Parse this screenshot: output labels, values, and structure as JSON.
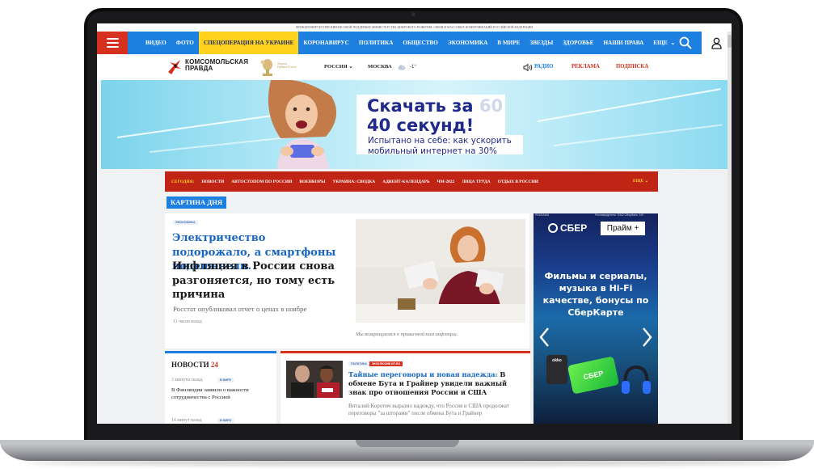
{
  "top_notice": "ФУНКЦИОНИРУЕТ ПРИ ФИНАНСОВОЙ ПОДДЕРЖКЕ МИНИСТЕРСТВА ЦИФРОВОГО РАЗВИТИЯ, СВЯЗИ И МАССОВЫХ КОММУНИКАЦИЙ РОССИЙСКОЙ ФЕДЕРАЦИИ",
  "nav": {
    "items": [
      "ВИДЕО",
      "ФОТО",
      "СПЕЦОПЕРАЦИЯ НА УКРАИНЕ",
      "КОРОНАВИРУС",
      "ПОЛИТИКА",
      "ОБЩЕСТВО",
      "ЭКОНОМИКА",
      "В МИРЕ",
      "ЗВЕЗДЫ",
      "ЗДОРОВЬЕ",
      "НАШИ ПРАВА",
      "ЕЩЕ"
    ],
    "highlight_index": 2,
    "accent": "#1d7fe0",
    "highlight_color": "#ffd21f"
  },
  "header": {
    "logo_line1": "КОМСОМОЛЬСКАЯ",
    "logo_line2": "ПРАВДА",
    "award_line1": "Лауреат",
    "award_line2": "Премии Рунета",
    "region": "РОССИЯ",
    "city": "МОСКВА",
    "temperature": "-1°",
    "radio": "РАДИО",
    "ads": "РЕКЛАМА",
    "subscribe": "ПОДПИСКА"
  },
  "banner": {
    "title_prefix": "Скачать за ",
    "title_struck": "60",
    "title_line2": "40 секунд!",
    "sub_line1": "Испытано на себе: как ускорить",
    "sub_line2": "мобильный интернет на 30%"
  },
  "subnav": {
    "items": [
      "СЕГОДНЯ:",
      "НОВОСТИ",
      "АВТОСТОПОМ ПО РОССИИ",
      "ВОЕНКОРЫ",
      "УКРАИНА: СВОДКА",
      "АДВЕНТ-КАЛЕНДАРЬ",
      "ЧМ-2022",
      "ЛИЦА ТРУДА",
      "ОТДЫХ В РОССИИ"
    ],
    "more": "ЕЩЕ"
  },
  "picture_of_day": "КАРТИНА ДНЯ",
  "lead": {
    "rubric": "ЭКОНОМИКА",
    "headline_blue": "Электричество подорожало, а смартфоны подешевели.",
    "headline_black": "Инфляция в России снова разгоняется, но тому есть причина",
    "description": "Росстат опубликовал отчет о ценах в ноябре",
    "time": "11 часов назад",
    "caption": "Мы возвращаемся к привычной нам инфляции."
  },
  "side_ad": {
    "label": "РЕКЛАМА",
    "advertiser": "Рекламодатель: ПАО Сбербанк. 18+",
    "brand": "СБЕР",
    "prime": "Прайм +",
    "text": "Фильмы и сериалы, музыка в Hi-Fi качестве, бонусы по СберКарте",
    "okko": "okko",
    "card_brand": "СБЕР"
  },
  "news": {
    "title": "НОВОСТИ",
    "badge": "24",
    "items": [
      {
        "time": "3 минуты назад",
        "tag": "В МИРЕ",
        "text": "В Финляндии заявили о важности сотрудничества с Россией"
      },
      {
        "time": "14 минут назад",
        "tag": "В МИРЕ"
      }
    ]
  },
  "story": {
    "tag1": "ПОЛИТИКА",
    "tag2": "ЭКСКЛЮЗИВ КП.RU",
    "headline_blue": "Тайные переговоры и новая надежда:",
    "headline_black": " В обмене Бута и Грайнер увидели важный знак про отношения России и США",
    "description": "Виталий Коротич выразил надежду, что Россия и США продолжат переговоры \"за шторами\" после обмена Бута и Грайнер"
  }
}
